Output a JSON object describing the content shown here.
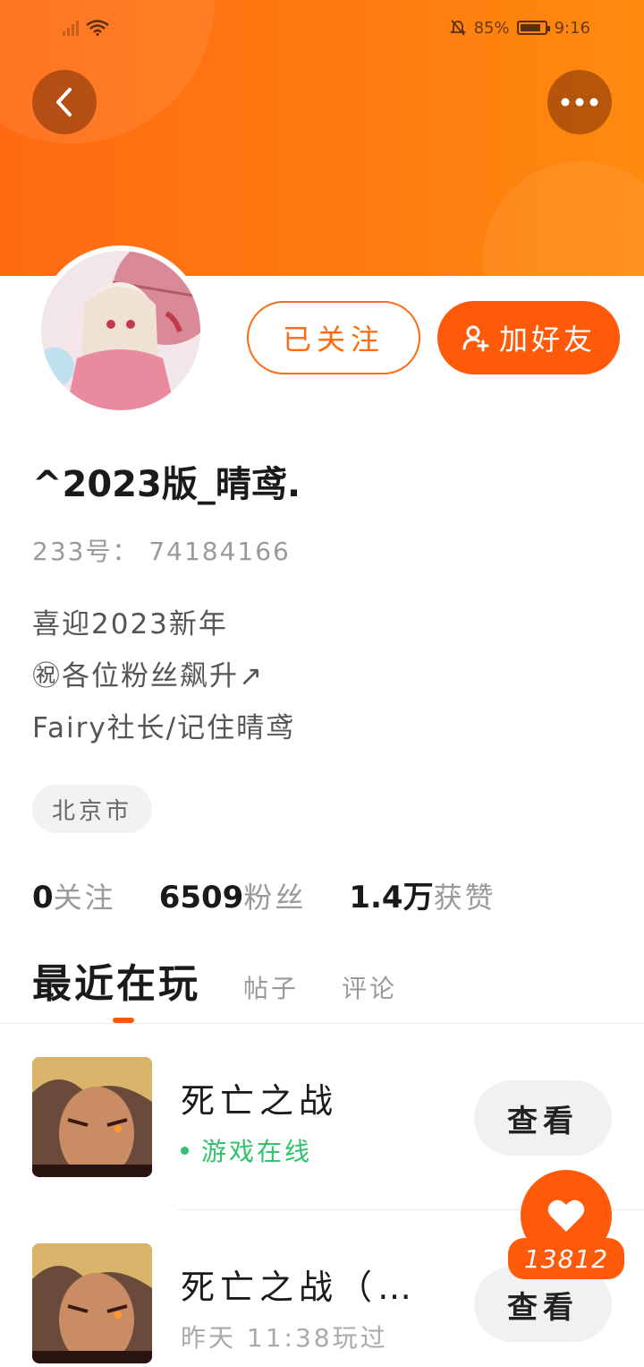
{
  "status_bar": {
    "battery": "85%",
    "time": "9:16"
  },
  "profile": {
    "username": "^2023版_晴鸢.",
    "uid": "233号： 74184166",
    "bio": [
      "喜迎2023新年",
      "㊗各位粉丝飙升↗",
      "Fairy社长/记住晴鸢"
    ],
    "location": "北京市",
    "follow_label": "已关注",
    "add_friend_label": "加好友"
  },
  "stats": [
    {
      "num": "0",
      "label": "关注"
    },
    {
      "num": "6509",
      "label": "粉丝"
    },
    {
      "num": "1.4万",
      "label": "获赞"
    }
  ],
  "tabs": {
    "active": "最近在玩",
    "others": [
      "帖子",
      "评论"
    ]
  },
  "games": [
    {
      "title": "死亡之战",
      "status": "游戏在线",
      "button": "查看"
    },
    {
      "title": "死亡之战（…",
      "status": "昨天 11:38玩过",
      "button": "查看"
    }
  ],
  "like": {
    "count": "13812"
  },
  "colors": {
    "accent": "#ff5a0a",
    "header": "#ff7b10",
    "online": "#2fc26a"
  }
}
